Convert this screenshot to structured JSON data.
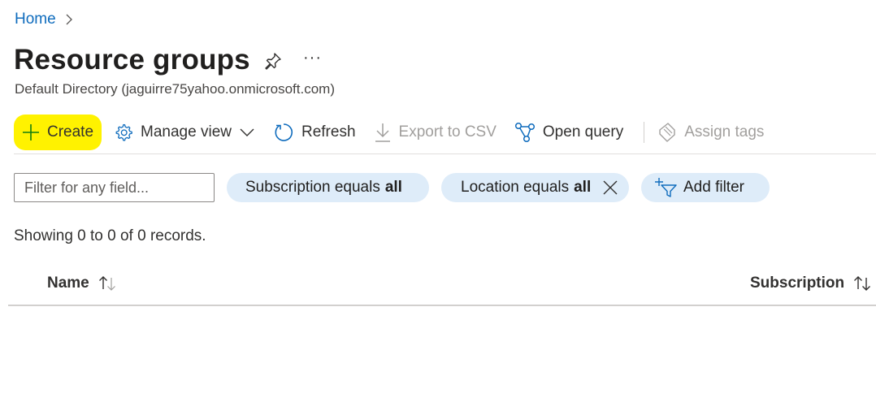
{
  "breadcrumb": {
    "home_label": "Home"
  },
  "header": {
    "title": "Resource groups",
    "more_label": "···",
    "subtitle": "Default Directory (jaguirre75yahoo.onmicrosoft.com)"
  },
  "toolbar": {
    "create_label": "Create",
    "manage_view_label": "Manage view",
    "refresh_label": "Refresh",
    "export_label": "Export to CSV",
    "open_query_label": "Open query",
    "assign_tags_label": "Assign tags"
  },
  "filters": {
    "search_placeholder": "Filter for any field...",
    "subscription_prefix": "Subscription equals",
    "subscription_value": "all",
    "location_prefix": "Location equals",
    "location_value": "all",
    "add_filter_label": "Add filter"
  },
  "records": {
    "showing_text": "Showing 0 to 0 of 0 records."
  },
  "table": {
    "columns": [
      {
        "label": "Name"
      },
      {
        "label": "Subscription"
      }
    ],
    "rows": []
  },
  "colors": {
    "accent": "#0f6cbd",
    "highlight": "#fff200",
    "pill_bg": "#deecf9",
    "create_icon": "#107c10"
  }
}
